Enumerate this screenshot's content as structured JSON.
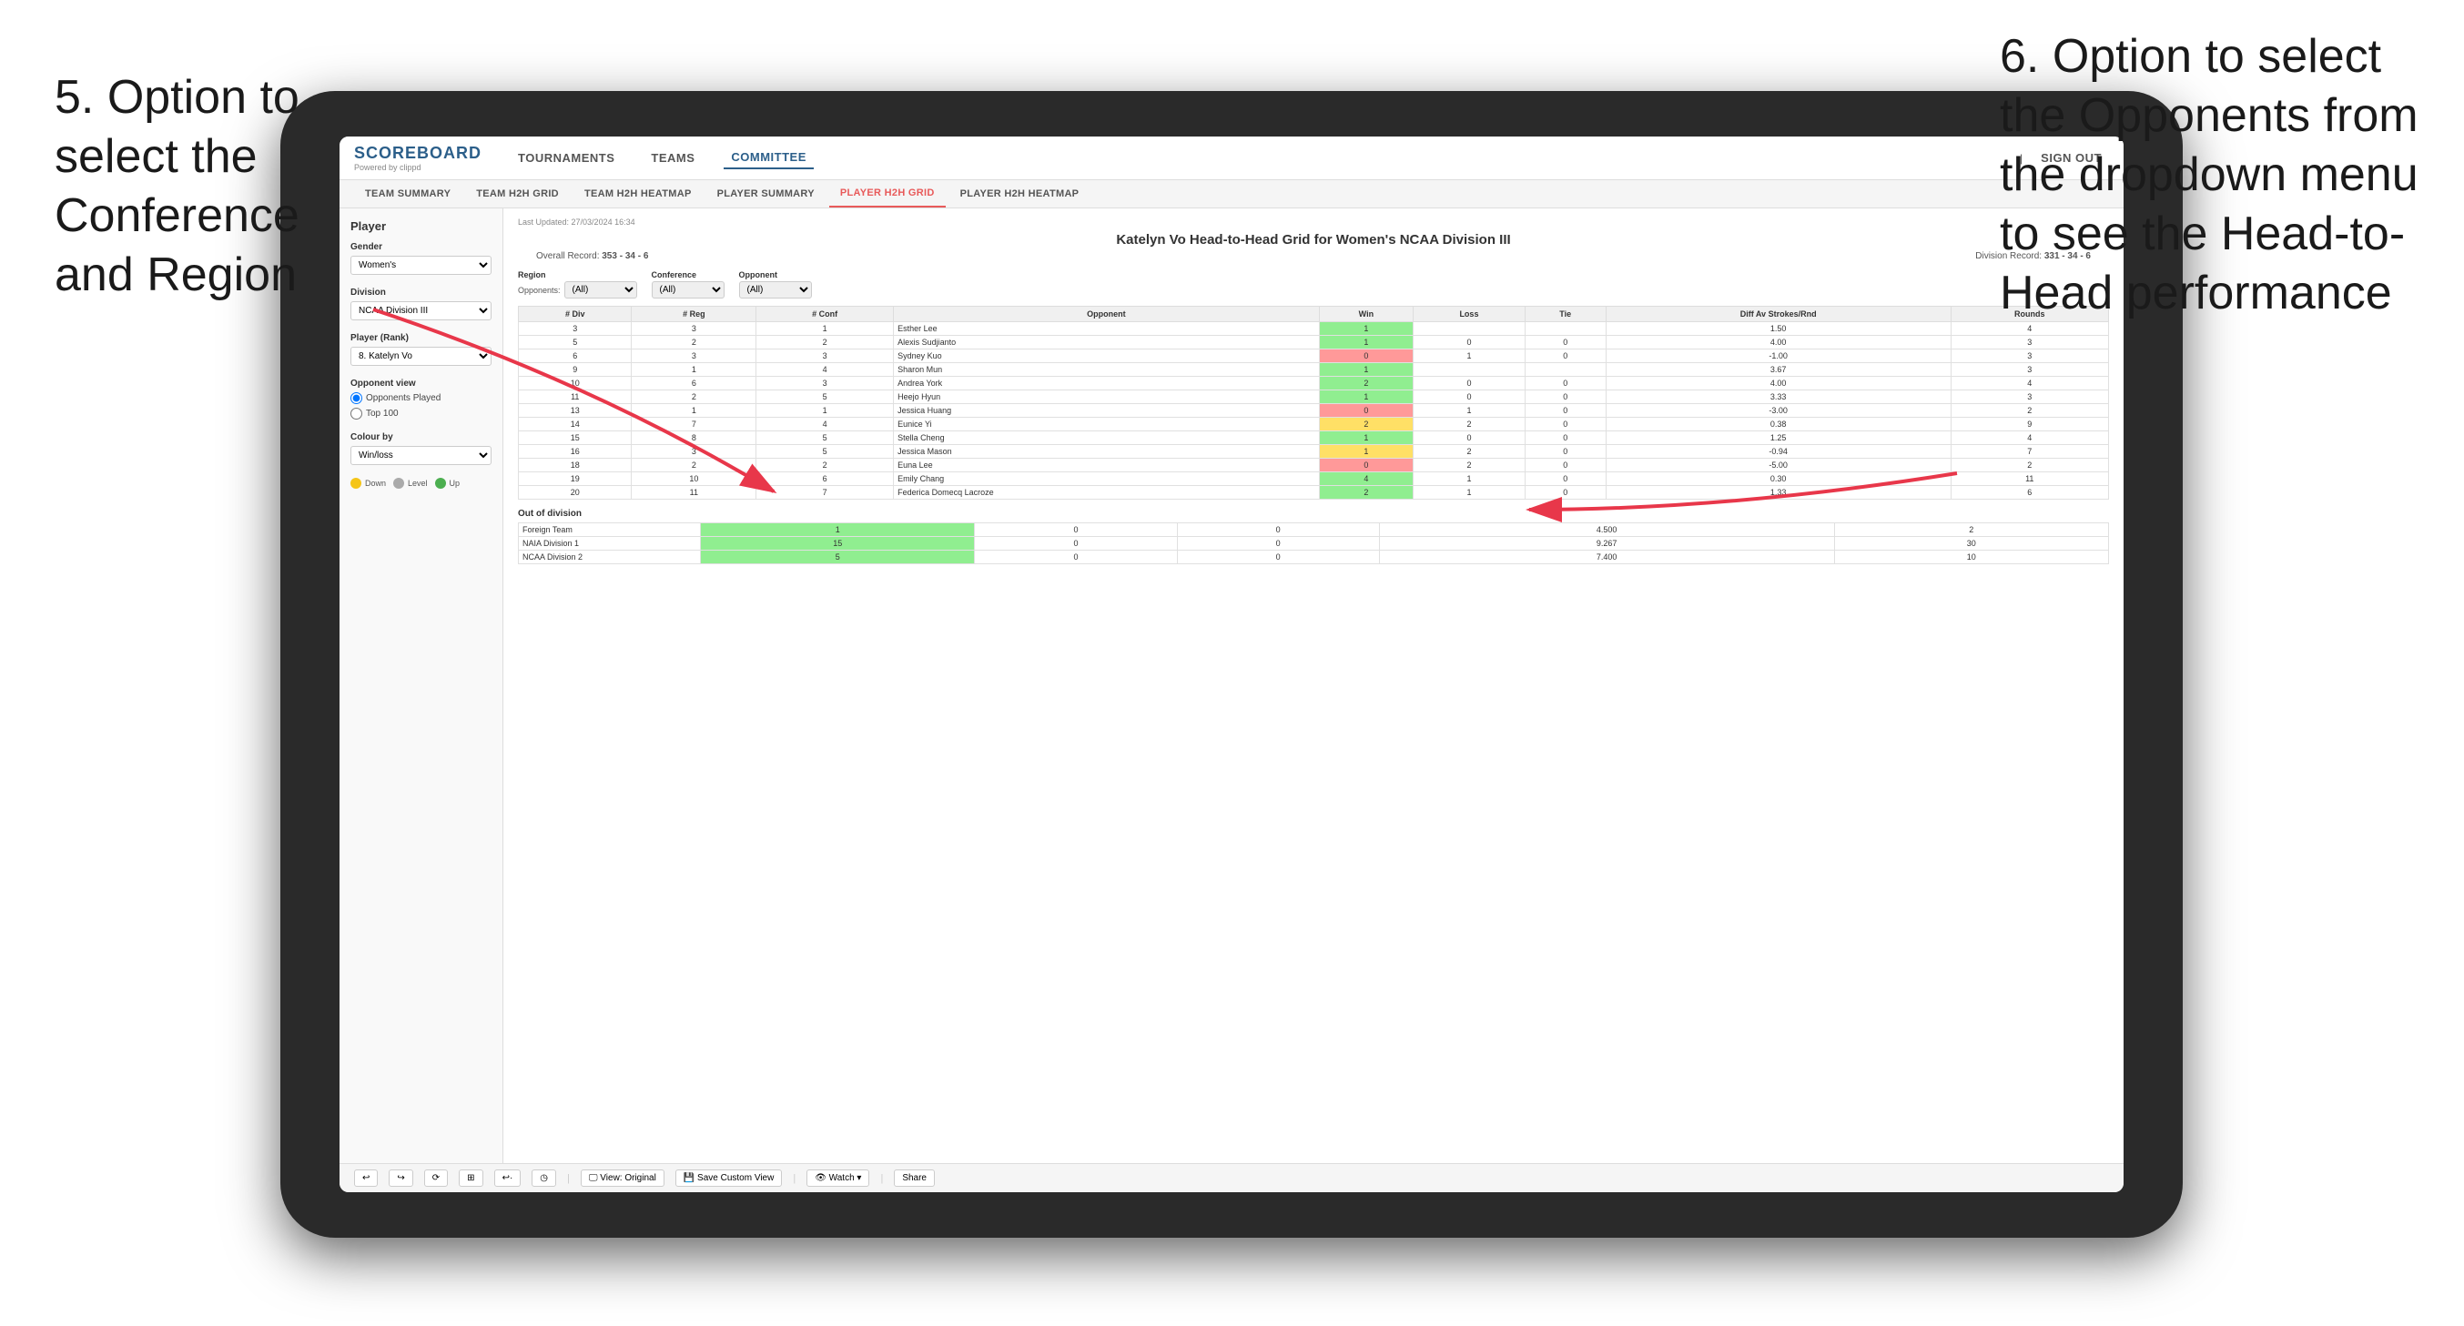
{
  "annotations": {
    "left": {
      "text": "5. Option to select the Conference and Region"
    },
    "right": {
      "text": "6. Option to select the Opponents from the dropdown menu to see the Head-to-Head performance"
    }
  },
  "nav": {
    "logo": "SCOREBOARD",
    "logo_sub": "Powered by clippd",
    "items": [
      "TOURNAMENTS",
      "TEAMS",
      "COMMITTEE"
    ],
    "active": "COMMITTEE",
    "sign_out": "Sign out"
  },
  "sub_nav": {
    "items": [
      "TEAM SUMMARY",
      "TEAM H2H GRID",
      "TEAM H2H HEATMAP",
      "PLAYER SUMMARY",
      "PLAYER H2H GRID",
      "PLAYER H2H HEATMAP"
    ],
    "active": "PLAYER H2H GRID"
  },
  "sidebar": {
    "title": "Player",
    "gender_label": "Gender",
    "gender_value": "Women's",
    "division_label": "Division",
    "division_value": "NCAA Division III",
    "player_rank_label": "Player (Rank)",
    "player_rank_value": "8. Katelyn Vo",
    "opponent_view_label": "Opponent view",
    "opponent_view_options": [
      "Opponents Played",
      "Top 100"
    ],
    "opponent_view_selected": "Opponents Played",
    "colour_by_label": "Colour by",
    "colour_by_value": "Win/loss",
    "legend": [
      {
        "color": "#f5c518",
        "label": "Down"
      },
      {
        "color": "#aaaaaa",
        "label": "Level"
      },
      {
        "color": "#4caf50",
        "label": "Up"
      }
    ]
  },
  "main": {
    "last_updated": "Last Updated: 27/03/2024 16:34",
    "title": "Katelyn Vo Head-to-Head Grid for Women's NCAA Division III",
    "overall_record": "353 - 34 - 6",
    "division_record": "331 - 34 - 6",
    "filters": {
      "region_label": "Region",
      "opponents_label": "Opponents:",
      "region_value": "(All)",
      "conference_label": "Conference",
      "conference_value": "(All)",
      "opponent_label": "Opponent",
      "opponent_value": "(All)"
    },
    "table_headers": [
      "# Div",
      "# Reg",
      "# Conf",
      "Opponent",
      "Win",
      "Loss",
      "Tie",
      "Diff Av Strokes/Rnd",
      "Rounds"
    ],
    "rows": [
      {
        "div": "3",
        "reg": "3",
        "conf": "1",
        "name": "Esther Lee",
        "win": "1",
        "loss": "",
        "tie": "",
        "diff": "1.50",
        "rounds": "4",
        "win_color": "green"
      },
      {
        "div": "5",
        "reg": "2",
        "conf": "2",
        "name": "Alexis Sudjianto",
        "win": "1",
        "loss": "0",
        "tie": "0",
        "diff": "4.00",
        "rounds": "3",
        "win_color": "green"
      },
      {
        "div": "6",
        "reg": "3",
        "conf": "3",
        "name": "Sydney Kuo",
        "win": "0",
        "loss": "1",
        "tie": "0",
        "diff": "-1.00",
        "rounds": "3",
        "win_color": "red"
      },
      {
        "div": "9",
        "reg": "1",
        "conf": "4",
        "name": "Sharon Mun",
        "win": "1",
        "loss": "",
        "tie": "",
        "diff": "3.67",
        "rounds": "3",
        "win_color": "green"
      },
      {
        "div": "10",
        "reg": "6",
        "conf": "3",
        "name": "Andrea York",
        "win": "2",
        "loss": "0",
        "tie": "0",
        "diff": "4.00",
        "rounds": "4",
        "win_color": "green"
      },
      {
        "div": "11",
        "reg": "2",
        "conf": "5",
        "name": "Heejo Hyun",
        "win": "1",
        "loss": "0",
        "tie": "0",
        "diff": "3.33",
        "rounds": "3",
        "win_color": "green"
      },
      {
        "div": "13",
        "reg": "1",
        "conf": "1",
        "name": "Jessica Huang",
        "win": "0",
        "loss": "1",
        "tie": "0",
        "diff": "-3.00",
        "rounds": "2",
        "win_color": "red"
      },
      {
        "div": "14",
        "reg": "7",
        "conf": "4",
        "name": "Eunice Yi",
        "win": "2",
        "loss": "2",
        "tie": "0",
        "diff": "0.38",
        "rounds": "9",
        "win_color": "yellow"
      },
      {
        "div": "15",
        "reg": "8",
        "conf": "5",
        "name": "Stella Cheng",
        "win": "1",
        "loss": "0",
        "tie": "0",
        "diff": "1.25",
        "rounds": "4",
        "win_color": "green"
      },
      {
        "div": "16",
        "reg": "3",
        "conf": "5",
        "name": "Jessica Mason",
        "win": "1",
        "loss": "2",
        "tie": "0",
        "diff": "-0.94",
        "rounds": "7",
        "win_color": "yellow"
      },
      {
        "div": "18",
        "reg": "2",
        "conf": "2",
        "name": "Euna Lee",
        "win": "0",
        "loss": "2",
        "tie": "0",
        "diff": "-5.00",
        "rounds": "2",
        "win_color": "red"
      },
      {
        "div": "19",
        "reg": "10",
        "conf": "6",
        "name": "Emily Chang",
        "win": "4",
        "loss": "1",
        "tie": "0",
        "diff": "0.30",
        "rounds": "11",
        "win_color": "green"
      },
      {
        "div": "20",
        "reg": "11",
        "conf": "7",
        "name": "Federica Domecq Lacroze",
        "win": "2",
        "loss": "1",
        "tie": "0",
        "diff": "1.33",
        "rounds": "6",
        "win_color": "green"
      }
    ],
    "out_of_division": "Out of division",
    "ood_rows": [
      {
        "name": "Foreign Team",
        "win": "1",
        "loss": "0",
        "tie": "0",
        "diff": "4.500",
        "rounds": "2"
      },
      {
        "name": "NAIA Division 1",
        "win": "15",
        "loss": "0",
        "tie": "0",
        "diff": "9.267",
        "rounds": "30"
      },
      {
        "name": "NCAA Division 2",
        "win": "5",
        "loss": "0",
        "tie": "0",
        "diff": "7.400",
        "rounds": "10"
      }
    ]
  },
  "toolbar": {
    "items": [
      "↩",
      "↪",
      "⟳",
      "⊡",
      "↩·",
      "◷",
      "|",
      "View: Original",
      "Save Custom View",
      "|",
      "Watch ▾",
      "|",
      "⬡",
      "⬡",
      "Share"
    ]
  }
}
